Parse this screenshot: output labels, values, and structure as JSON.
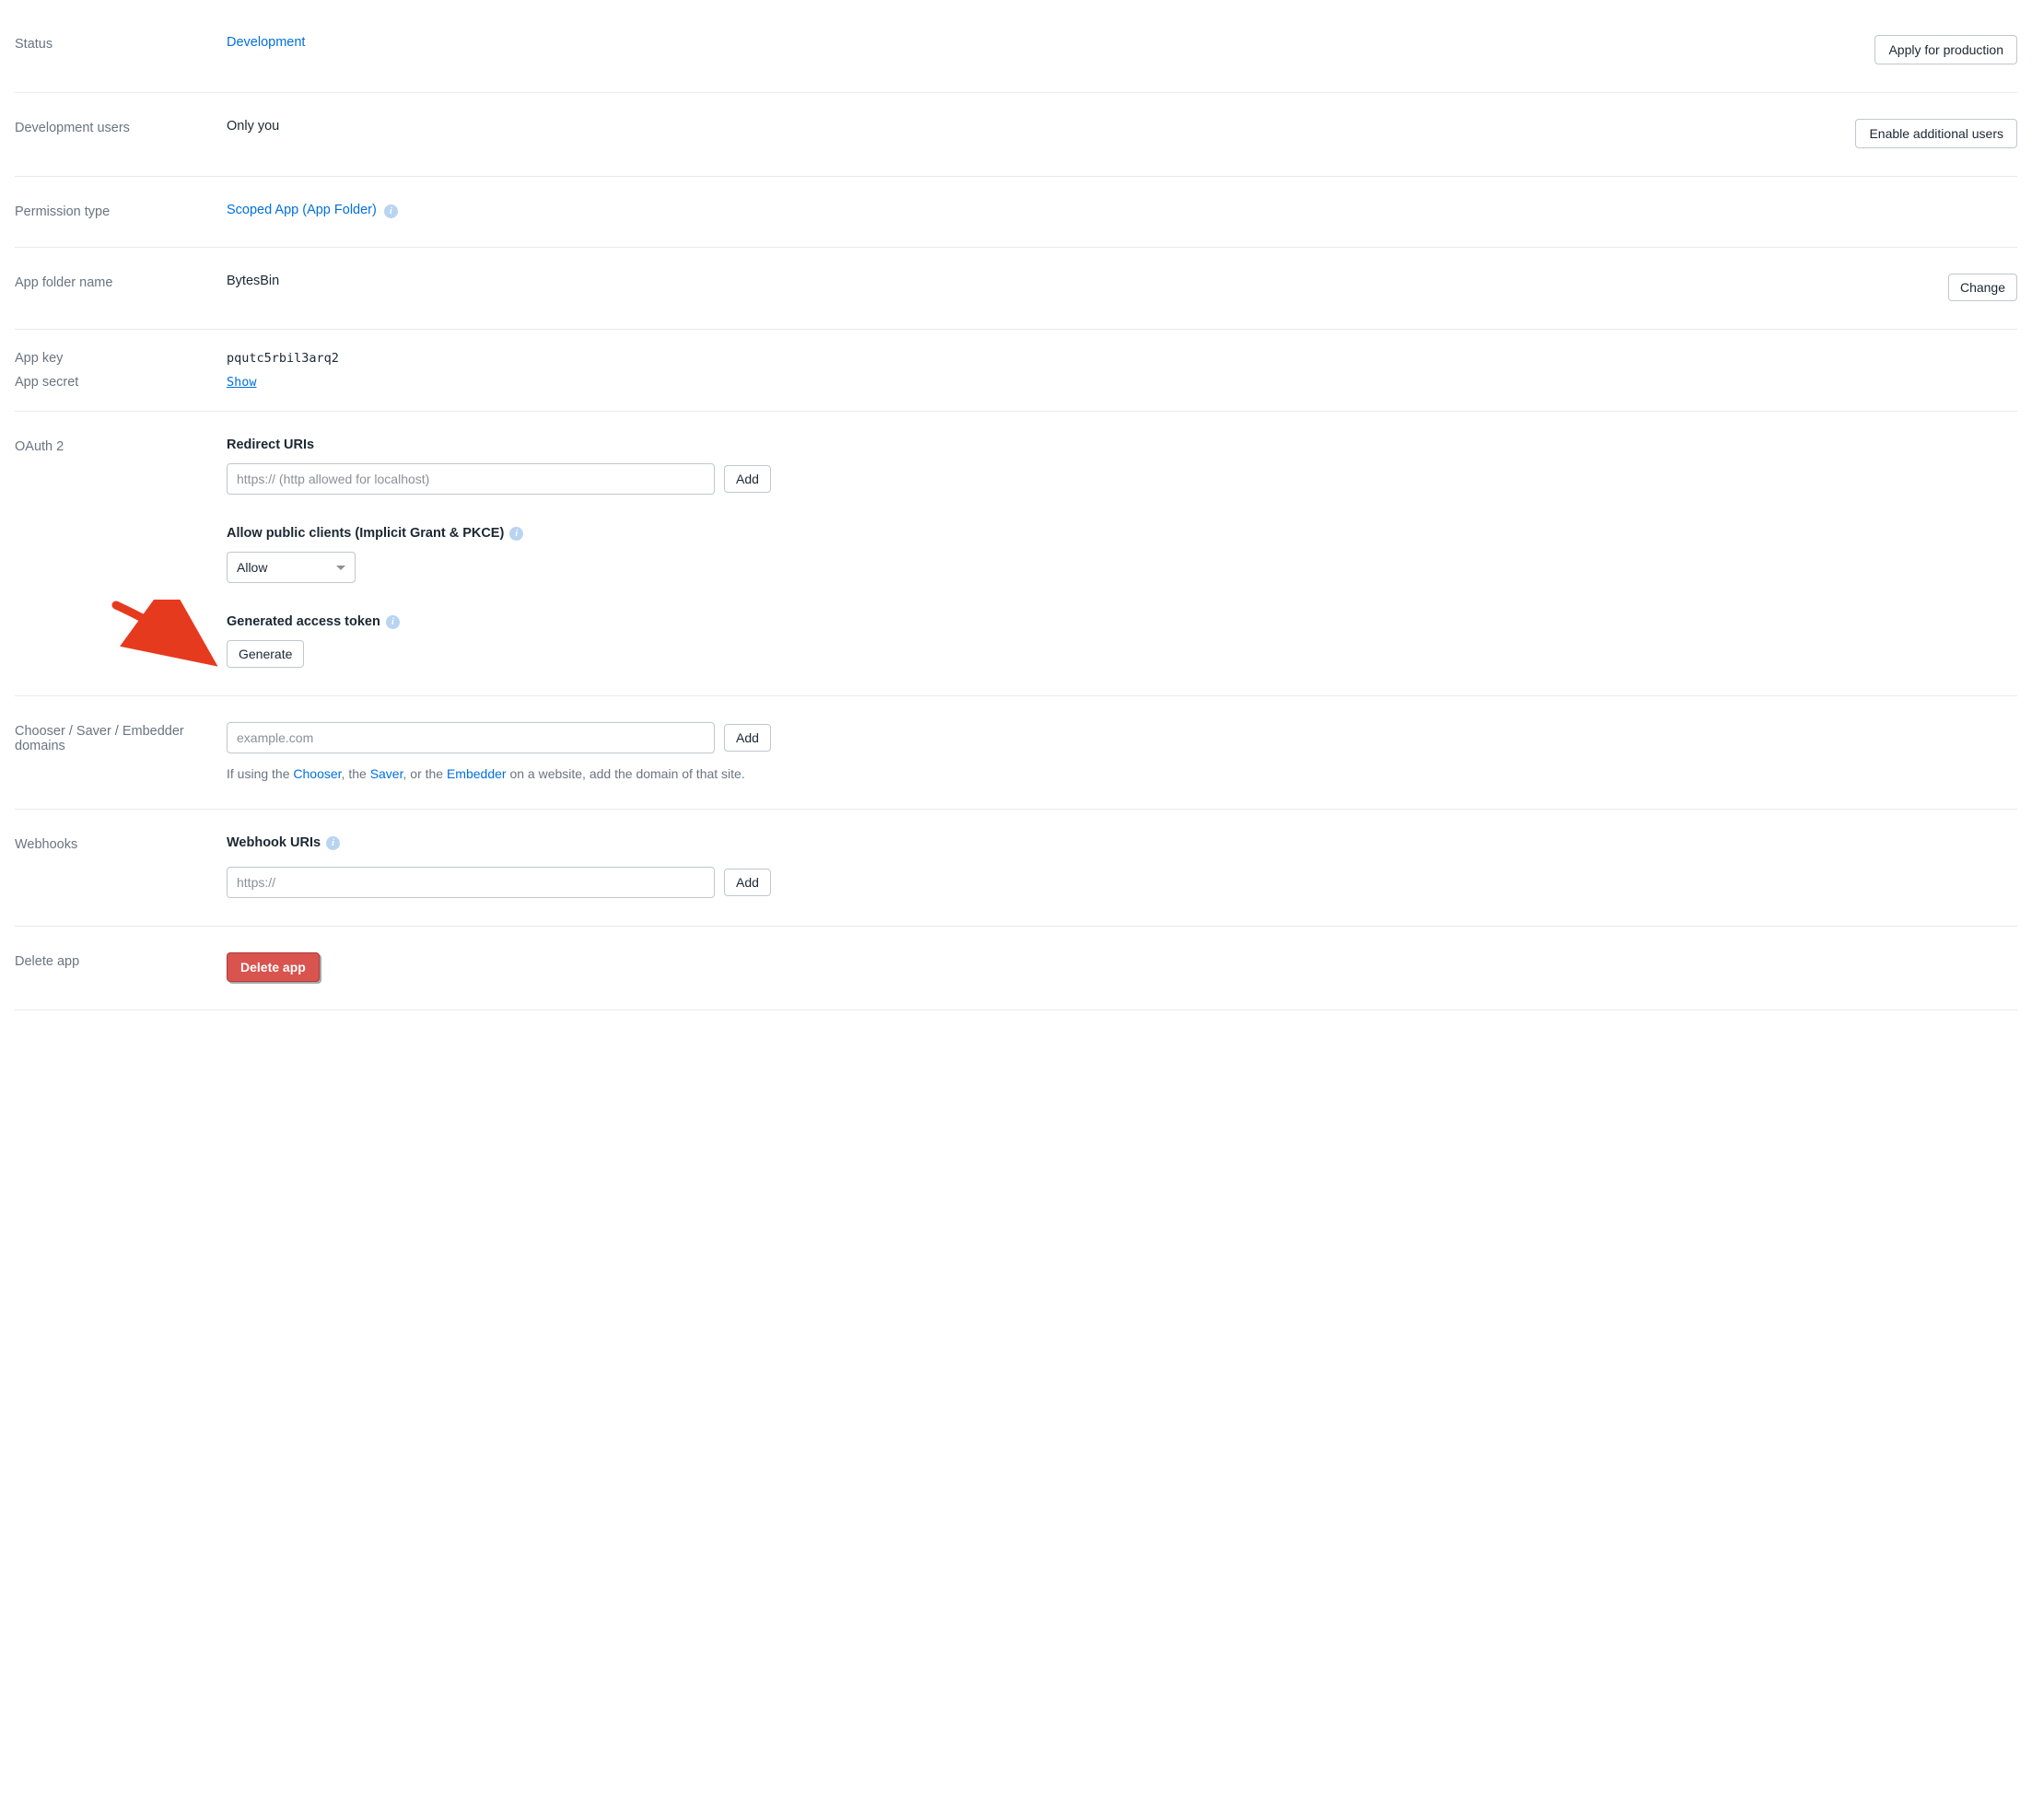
{
  "status": {
    "label": "Status",
    "value": "Development",
    "action": "Apply for production"
  },
  "dev_users": {
    "label": "Development users",
    "value": "Only you",
    "action": "Enable additional users"
  },
  "permission": {
    "label": "Permission type",
    "value": "Scoped App (App Folder)"
  },
  "folder": {
    "label": "App folder name",
    "value": "BytesBin",
    "action": "Change"
  },
  "appkey": {
    "label": "App key",
    "value": "pqutc5rbil3arq2"
  },
  "appsecret": {
    "label": "App secret",
    "value": "Show"
  },
  "oauth": {
    "label": "OAuth 2",
    "redirect_heading": "Redirect URIs",
    "redirect_placeholder": "https:// (http allowed for localhost)",
    "redirect_add": "Add",
    "pkce_heading": "Allow public clients (Implicit Grant & PKCE)",
    "pkce_select": "Allow",
    "token_heading": "Generated access token",
    "token_generate": "Generate"
  },
  "chooser": {
    "label": "Chooser / Saver / Embedder domains",
    "placeholder": "example.com",
    "add": "Add",
    "helper_prefix": "If using the ",
    "helper_chooser": "Chooser",
    "helper_mid1": ", the ",
    "helper_saver": "Saver",
    "helper_mid2": ", or the ",
    "helper_embedder": "Embedder",
    "helper_suffix": " on a website, add the domain of that site."
  },
  "webhooks": {
    "label": "Webhooks",
    "heading": "Webhook URIs",
    "placeholder": "https://",
    "add": "Add"
  },
  "delete": {
    "label": "Delete app",
    "action": "Delete app"
  },
  "info_glyph": "i"
}
